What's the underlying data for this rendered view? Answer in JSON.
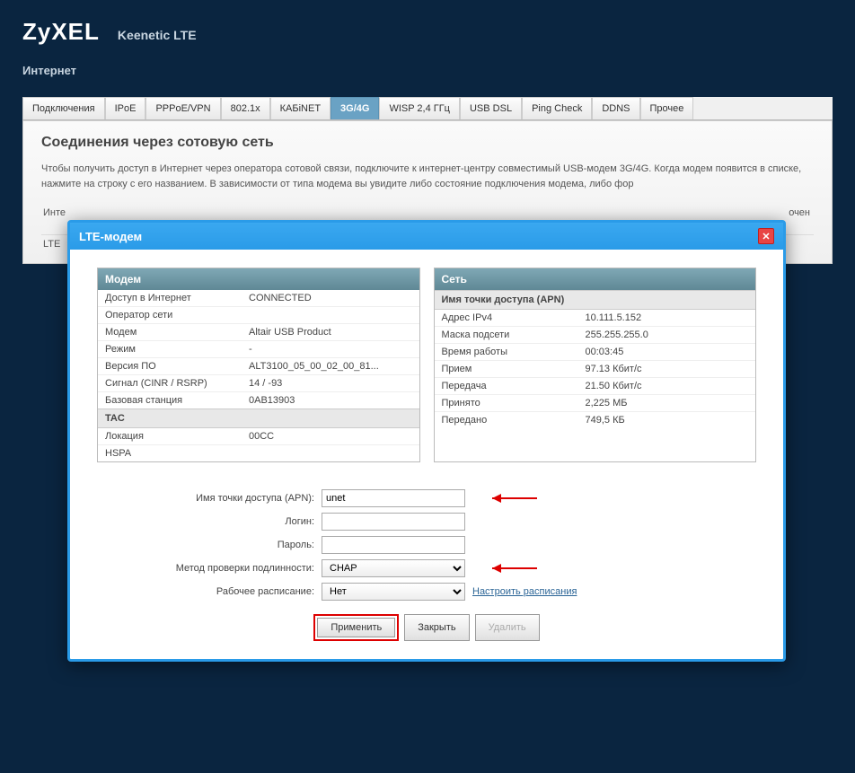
{
  "header": {
    "logo": "ZyXEL",
    "model": "Keenetic LTE",
    "section": "Интернет"
  },
  "tabs": [
    "Подключения",
    "IPoE",
    "PPPoE/VPN",
    "802.1x",
    "КАБiNET",
    "3G/4G",
    "WISP 2,4 ГГц",
    "USB DSL",
    "Ping Check",
    "DDNS",
    "Прочее"
  ],
  "active_tab": 5,
  "page": {
    "title": "Соединения через сотовую сеть",
    "desc": "Чтобы получить доступ в Интернет через оператора сотовой связи, подключите к интернет-центру совместимый USB-модем 3G/4G. Когда модем появится в списке, нажмите на строку с его названием. В зависимости от типа модема вы увидите либо состояние подключения модема, либо фор"
  },
  "bg_table": {
    "left_h": "Инте",
    "right_h": "очен",
    "row1_left": "LTE"
  },
  "modal": {
    "title": "LTE-модем",
    "left": {
      "head": "Модем",
      "rows": [
        {
          "k": "Доступ в Интернет",
          "v": "CONNECTED"
        },
        {
          "k": "Оператор сети",
          "v": ""
        },
        {
          "k": "Модем",
          "v": "Altair USB Product"
        },
        {
          "k": "Режим",
          "v": "-"
        },
        {
          "k": "Версия ПО",
          "v": "ALT3100_05_00_02_00_81..."
        },
        {
          "k": "Сигнал (CINR / RSRP)",
          "v": "14 / -93"
        },
        {
          "k": "Базовая станция",
          "v": "0AB13903"
        }
      ],
      "sub2": "TAC",
      "rows2": [
        {
          "k": "Локация",
          "v": "00CC"
        },
        {
          "k": "HSPA",
          "v": ""
        }
      ]
    },
    "right": {
      "head": "Сеть",
      "sub": "Имя точки доступа (APN)",
      "rows": [
        {
          "k": "Адрес IPv4",
          "v": "10.111.5.152"
        },
        {
          "k": "Маска подсети",
          "v": "255.255.255.0"
        },
        {
          "k": "Время работы",
          "v": "00:03:45"
        },
        {
          "k": "Прием",
          "v": "97.13 Кбит/с"
        },
        {
          "k": "Передача",
          "v": "21.50 Кбит/с"
        },
        {
          "k": "Принято",
          "v": "2,225 МБ"
        },
        {
          "k": "Передано",
          "v": "749,5 КБ"
        }
      ]
    },
    "form": {
      "apn_label": "Имя точки доступа (APN):",
      "apn_value": "unet",
      "login_label": "Логин:",
      "login_value": "",
      "pass_label": "Пароль:",
      "pass_value": "",
      "auth_label": "Метод проверки подлинности:",
      "auth_value": "CHAP",
      "sched_label": "Рабочее расписание:",
      "sched_value": "Нет",
      "sched_link": "Настроить расписания"
    },
    "buttons": {
      "apply": "Применить",
      "close": "Закрыть",
      "delete": "Удалить"
    }
  }
}
